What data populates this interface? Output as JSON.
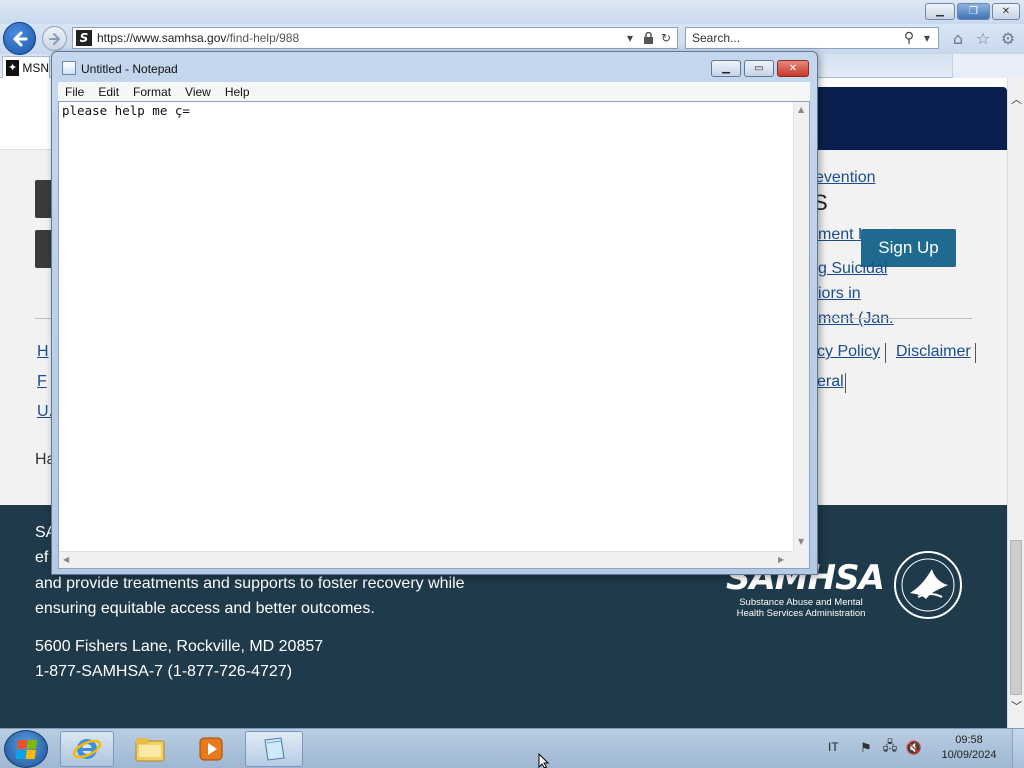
{
  "browser": {
    "url_host": "https://www.samhsa.gov",
    "url_path": "/find-help/988",
    "search_placeholder": "Search...",
    "tab_label": "MSN"
  },
  "page": {
    "partial_link": "evention",
    "partial_heading": "S",
    "list_links": [
      "ment Locator",
      "g Suicidal",
      "iors in",
      "ment (Jan."
    ],
    "signup_label": "Sign Up",
    "footer_links": [
      "cy Policy",
      "Disclaimer",
      "eral"
    ],
    "left_cut": [
      "H",
      "F",
      "U."
    ],
    "ha_text": "Ha",
    "footer_lines": [
      "SA",
      "ef",
      "and provide treatments and supports to foster recovery while",
      "ensuring equitable access and better outcomes."
    ],
    "address": "5600 Fishers Lane, Rockville, MD 20857",
    "phone": "1-877-SAMHSA-7 (1-877-726-4727)",
    "logo_wordmark": "SAMHSA",
    "logo_sub": "Substance Abuse and Mental Health Services Administration"
  },
  "notepad": {
    "title": "Untitled - Notepad",
    "menu": [
      "File",
      "Edit",
      "Format",
      "View",
      "Help"
    ],
    "content": "please help me ç="
  },
  "taskbar": {
    "language": "IT",
    "time": "09:58",
    "date": "10/09/2024"
  },
  "colors": {
    "footer_bg": "#1f3a4a",
    "signup_bg": "#1f6a8f",
    "link": "#1a4d8f",
    "card_bg": "#0a1f4e"
  }
}
